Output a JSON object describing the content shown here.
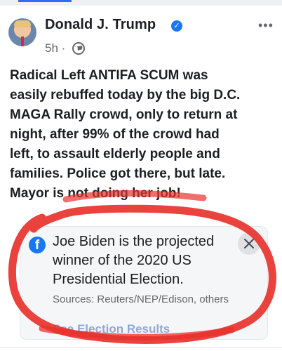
{
  "post": {
    "author": "Donald J. Trump",
    "time": "5h",
    "separator": "·",
    "more_label": "•••",
    "icons": {
      "verified": "verified-badge-icon",
      "audience": "globe-icon",
      "more": "more-options-icon"
    },
    "text_lines": [
      "Radical Left ANTIFA SCUM was",
      "easily rebuffed today by the big D.C.",
      "MAGA Rally crowd, only to return at",
      "night, after 99% of the crowd had",
      "left, to assault elderly people and",
      "families. Police got there, but late.",
      "Mayor is not doing her job!"
    ]
  },
  "notice": {
    "title": "Joe Biden is the projected winner of the 2020 US Presidential Election.",
    "sources": "Sources: Reuters/NEP/Edison, others",
    "link_label": "See Election Results",
    "icons": {
      "brand": "facebook-icon",
      "close": "close-icon"
    }
  },
  "colors": {
    "accent": "#1877f2",
    "circle_ink": "#e8322d",
    "muted_text": "#65676b"
  }
}
